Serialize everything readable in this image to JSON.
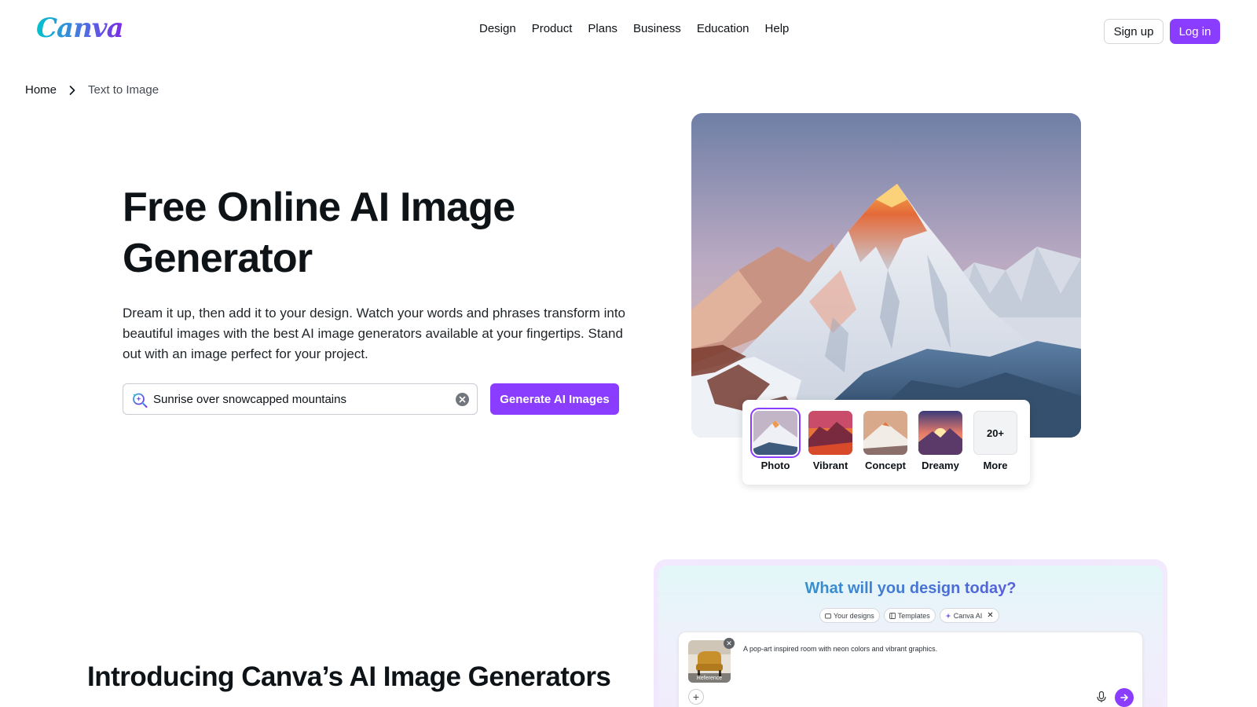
{
  "header": {
    "logo": "Canva",
    "nav": [
      "Design",
      "Product",
      "Plans",
      "Business",
      "Education",
      "Help"
    ],
    "signup_label": "Sign up",
    "login_label": "Log in"
  },
  "breadcrumb": {
    "home": "Home",
    "current": "Text to Image"
  },
  "hero": {
    "title": "Free Online AI Image Generator",
    "description": "Dream it up, then add it to your design. Watch your words and phrases transform into beautiful images with the best AI image generators available at your fingertips. Stand out with an image perfect for your project.",
    "search_value": "Sunrise over snowcapped mountains",
    "generate_label": "Generate AI Images"
  },
  "styles": {
    "selected": "Photo",
    "options": [
      {
        "label": "Photo"
      },
      {
        "label": "Vibrant"
      },
      {
        "label": "Concept"
      },
      {
        "label": "Dreamy"
      },
      {
        "label": "More",
        "badge": "20+"
      }
    ]
  },
  "section2": {
    "title": "Introducing Canva’s AI Image Generators"
  },
  "preview": {
    "title": "What will you design today?",
    "chips": [
      "Your designs",
      "Templates",
      "Canva AI"
    ],
    "reference_label": "Reference",
    "prompt": "A pop-art inspired room with neon colors and vibrant graphics."
  },
  "colors": {
    "accent": "#8b3dff",
    "text": "#0e1318"
  }
}
